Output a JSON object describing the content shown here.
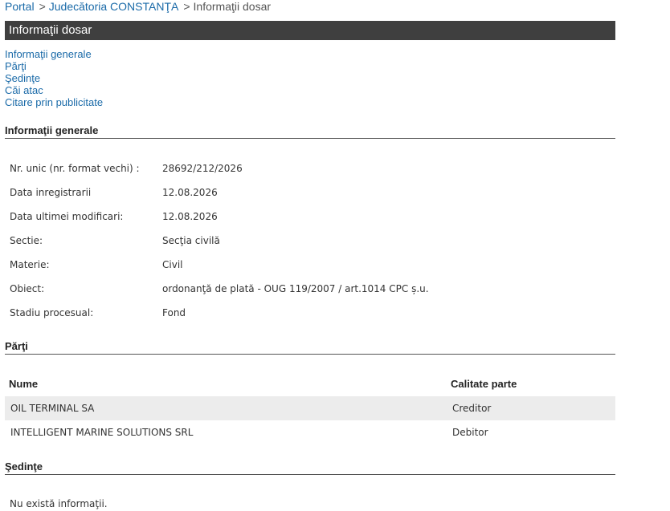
{
  "breadcrumb": {
    "portal": "Portal",
    "sep1": ">",
    "court": "Judecătoria CONSTANŢA",
    "sep2": ">",
    "current": "Informaţii dosar"
  },
  "title": "Informaţii dosar",
  "toc": {
    "general": "Informaţii generale",
    "parti": "Părţi",
    "sedinte": "Şedinţe",
    "cai_atac": "Căi atac",
    "citare": "Citare prin publicitate"
  },
  "general": {
    "heading": "Informaţii generale",
    "rows": [
      {
        "label": "Nr. unic (nr. format vechi) :",
        "value": "28692/212/2026"
      },
      {
        "label": "Data inregistrarii",
        "value": "12.08.2026"
      },
      {
        "label": "Data ultimei modificari:",
        "value": "12.08.2026"
      },
      {
        "label": "Sectie:",
        "value": "Secţia civilă"
      },
      {
        "label": "Materie:",
        "value": "Civil"
      },
      {
        "label": "Obiect:",
        "value": "ordonanţă de plată - OUG 119/2007 / art.1014 CPC ș.u."
      },
      {
        "label": "Stadiu procesual:",
        "value": "Fond"
      }
    ]
  },
  "parti": {
    "heading": "Părţi",
    "columns": {
      "name": "Nume",
      "role": "Calitate parte"
    },
    "rows": [
      {
        "name": "OIL TERMINAL SA",
        "role": "Creditor"
      },
      {
        "name": "INTELLIGENT MARINE SOLUTIONS SRL",
        "role": "Debitor"
      }
    ]
  },
  "sedinte": {
    "heading": "Şedinţe",
    "empty": "Nu există informaţii."
  }
}
